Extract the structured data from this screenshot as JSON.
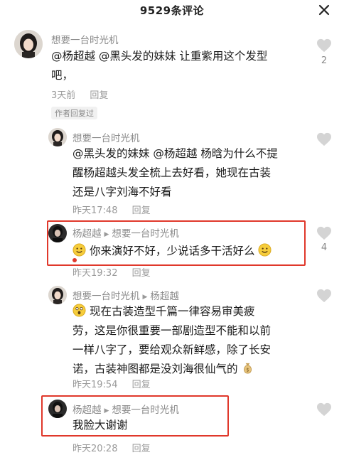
{
  "header": {
    "title": "9529条评论"
  },
  "comments": [
    {
      "user": "想要一台时光机",
      "text_lines": [
        "@杨超越 @黑头发的妹妹 让重紫用这个发型",
        "吧，"
      ],
      "time": "3天前",
      "reply_label": "回复",
      "likes": "2",
      "author_tag": "作者回复过"
    },
    {
      "user": "想要一台时光机",
      "text_lines": [
        "@黑头发的妹妹 @杨超越 杨晗为什么不提",
        "醒杨超越头发全梳上去好看，她现在古装",
        "还是八字刘海不好看"
      ],
      "time": "昨天17:48",
      "reply_label": "回复"
    },
    {
      "user": "杨超越",
      "reply_to": "想要一台时光机",
      "text": "你来演好不好，少说话多干活好么",
      "time": "昨天19:32",
      "reply_label": "回复",
      "likes": "4"
    },
    {
      "user": "想要一台时光机",
      "reply_to": "杨超越",
      "text_lines": [
        "现在古装造型千篇一律容易审美疲",
        "劳，这是你很重要一部剧造型不能和以前",
        "一样八字了，要给观众新鲜感，除了长安",
        "诺，古装神图都是没刘海很仙气的"
      ],
      "time": "昨天19:54",
      "reply_label": "回复"
    },
    {
      "user": "杨超越",
      "reply_to": "想要一台时光机",
      "text": "我脸大谢谢",
      "time": "昨天20:28",
      "reply_label": "回复"
    }
  ],
  "colors": {
    "highlight": "#e0382b",
    "muted": "#8a8a8a",
    "heart": "#d4d4d4"
  },
  "icons": [
    "close-icon",
    "heart-icon",
    "smile-emoji-icon",
    "shocked-emoji-icon",
    "money-bag-emoji-icon",
    "reply-arrow-icon"
  ]
}
